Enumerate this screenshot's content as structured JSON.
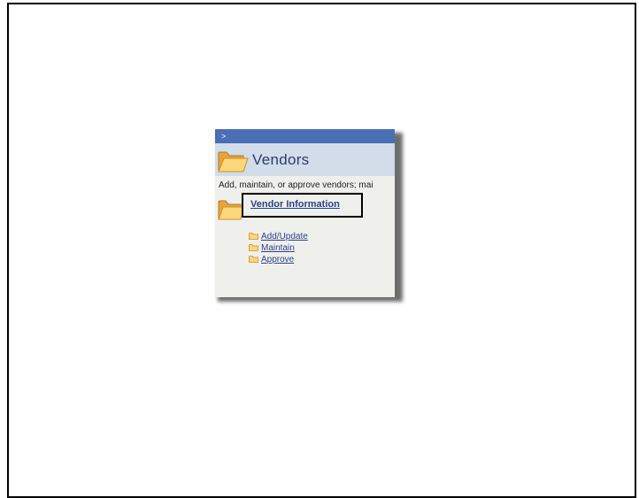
{
  "panel": {
    "header_marker": ">",
    "title": "Vendors",
    "description": "Add, maintain, or approve vendors; mai",
    "folder_icon": "folder-icon",
    "accent_color": "#4a6fb5",
    "title_band_color": "#d3dce9",
    "link_color": "#2d3f8a",
    "section": {
      "label": "Vendor Information",
      "items": [
        {
          "label": "Add/Update"
        },
        {
          "label": "Maintain"
        },
        {
          "label": "Approve"
        }
      ]
    }
  }
}
